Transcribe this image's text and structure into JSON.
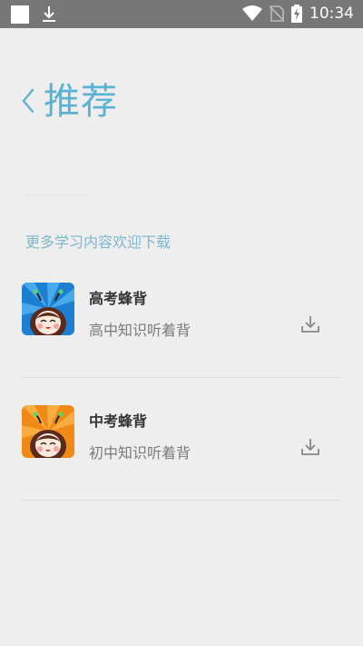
{
  "status_bar": {
    "time": "10:34",
    "icons": [
      "square-notification-icon",
      "download-notification-icon",
      "wifi-icon",
      "no-sim-icon",
      "battery-charging-icon"
    ]
  },
  "header": {
    "back_icon": "chevron-left-icon",
    "title": "推荐"
  },
  "section_label": "更多学习内容欢迎下载",
  "apps": [
    {
      "name": "高考蜂背",
      "desc": "高中知识听着背",
      "icon_bg": "#1d7fd1"
    },
    {
      "name": "中考蜂背",
      "desc": "初中知识听着背",
      "icon_bg": "#f08a17"
    }
  ],
  "colors": {
    "accent": "#5bb2d2",
    "section_label": "#7fb7cd",
    "status_bar": "#777777",
    "background": "#eeeeee"
  }
}
